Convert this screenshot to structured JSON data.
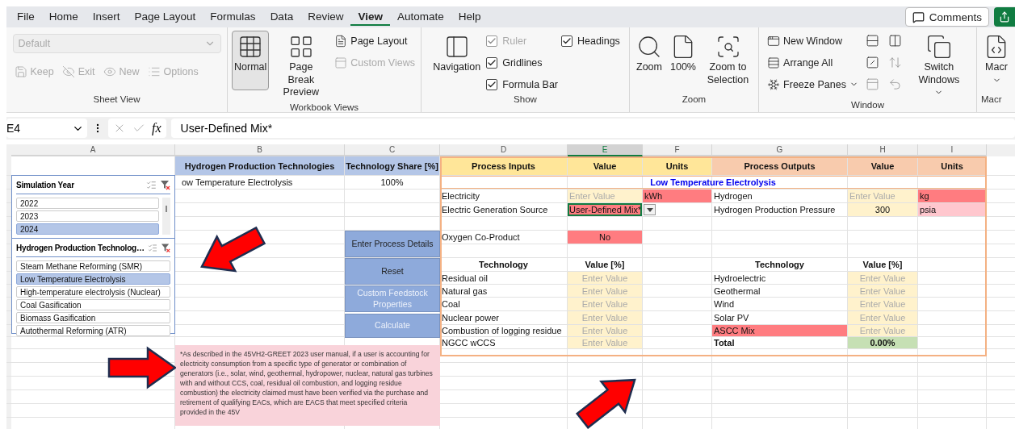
{
  "menu": [
    {
      "label": "File",
      "selected": false
    },
    {
      "label": "Home",
      "selected": false
    },
    {
      "label": "Insert",
      "selected": false
    },
    {
      "label": "Page Layout",
      "selected": false
    },
    {
      "label": "Formulas",
      "selected": false
    },
    {
      "label": "Data",
      "selected": false
    },
    {
      "label": "Review",
      "selected": false
    },
    {
      "label": "View",
      "selected": true
    },
    {
      "label": "Automate",
      "selected": false
    },
    {
      "label": "Help",
      "selected": false
    }
  ],
  "comments_button": "Comments",
  "ribbon": [
    {
      "label": "Sheet View",
      "columns": [
        [
          {
            "kind": "select",
            "value": "Default",
            "disabled": true
          },
          {
            "kind": "row",
            "items": [
              {
                "kind": "small",
                "label": "Keep",
                "disabled": true
              },
              {
                "kind": "small",
                "label": "Exit",
                "disabled": true
              },
              {
                "kind": "small",
                "label": "New",
                "disabled": true
              },
              {
                "kind": "small",
                "label": "Options",
                "disabled": true
              }
            ]
          }
        ]
      ]
    },
    {
      "label": "Workbook Views",
      "columns": [
        [
          {
            "kind": "large",
            "label": "Normal",
            "selected": true
          }
        ],
        [
          {
            "kind": "large",
            "label": "Page Break Preview",
            "selected": false
          }
        ],
        [
          {
            "kind": "small",
            "label": "Page Layout",
            "disabled": false
          },
          {
            "kind": "small",
            "label": "Custom Views",
            "disabled": true
          }
        ]
      ]
    },
    {
      "label": "Show",
      "columns": [
        [
          {
            "kind": "large",
            "label": "Navigation",
            "selected": false
          }
        ],
        [
          {
            "kind": "check",
            "label": "Ruler",
            "checked": true,
            "disabled": true
          },
          {
            "kind": "check",
            "label": "Gridlines",
            "checked": true,
            "disabled": false
          },
          {
            "kind": "check",
            "label": "Formula Bar",
            "checked": true,
            "disabled": false
          }
        ],
        [
          {
            "kind": "check",
            "label": "Headings",
            "checked": true,
            "disabled": false
          }
        ]
      ]
    },
    {
      "label": "Zoom",
      "columns": [
        [
          {
            "kind": "large",
            "label": "Zoom",
            "selected": false
          }
        ],
        [
          {
            "kind": "large",
            "label": "100%",
            "selected": false
          }
        ],
        [
          {
            "kind": "large",
            "label": "Zoom to Selection",
            "selected": false
          }
        ]
      ]
    },
    {
      "label": "Window",
      "columns": [
        [
          {
            "kind": "small",
            "label": "New Window",
            "disabled": false
          },
          {
            "kind": "small",
            "label": "Arrange All",
            "disabled": false
          },
          {
            "kind": "small",
            "label": "Freeze Panes",
            "disabled": false,
            "caret": true
          }
        ],
        [
          {
            "kind": "icon",
            "disabled": false
          },
          {
            "kind": "icon",
            "disabled": false
          },
          {
            "kind": "icon",
            "disabled": true
          }
        ],
        [
          {
            "kind": "icon",
            "disabled": false
          },
          {
            "kind": "icon",
            "disabled": true
          },
          {
            "kind": "icon",
            "disabled": true
          }
        ],
        [
          {
            "kind": "large",
            "label": "Switch Windows",
            "selected": false,
            "caret": true
          }
        ]
      ]
    },
    {
      "label": "Macr",
      "columns": [
        [
          {
            "kind": "large",
            "label": "Macr",
            "selected": false,
            "caret": true
          }
        ]
      ]
    }
  ],
  "name_box": "E4",
  "function_label": "fx",
  "formula": "User-Defined Mix*",
  "columns": [
    {
      "label": "A",
      "selected": false
    },
    {
      "label": "B",
      "selected": false
    },
    {
      "label": "C",
      "selected": false
    },
    {
      "label": "D",
      "selected": false
    },
    {
      "label": "E",
      "selected": true
    },
    {
      "label": "F",
      "selected": false
    },
    {
      "label": "G",
      "selected": false
    },
    {
      "label": "H",
      "selected": false
    },
    {
      "label": "I",
      "selected": false
    }
  ],
  "header_row": [
    {
      "text": "Hydrogen Production Technologies",
      "kind": "technology"
    },
    {
      "text": "Technology Share [%]",
      "kind": "technology"
    },
    {
      "text": "Process Inputs",
      "kind": "input"
    },
    {
      "text": "Value",
      "kind": "input"
    },
    {
      "text": "Units",
      "kind": "input"
    },
    {
      "text": "Process Outputs",
      "kind": "output"
    },
    {
      "text": "Value",
      "kind": "output"
    },
    {
      "text": "Units",
      "kind": "output"
    }
  ],
  "rows": [
    {
      "cells": [
        null,
        {
          "text": "ow Temperature Electrolysis",
          "kind": "text"
        },
        {
          "text": "100%",
          "kind": "center"
        },
        {
          "text": "Low Temperature Electrolysis",
          "kind": "title"
        },
        null,
        null,
        null,
        null,
        null
      ]
    },
    {
      "cells": [
        null,
        null,
        null,
        {
          "text": "Electricity",
          "kind": "text"
        },
        {
          "text": "Enter Value",
          "kind": "hint"
        },
        {
          "text": "kWh",
          "kind": "required"
        },
        {
          "text": "Hydrogen",
          "kind": "text"
        },
        {
          "text": "Enter Value",
          "kind": "hint"
        },
        {
          "text": "kg",
          "kind": "required"
        }
      ]
    },
    {
      "cells": [
        null,
        null,
        null,
        {
          "text": "Electric Generation Source",
          "kind": "text"
        },
        {
          "text": "User-Defined Mix*",
          "kind": "dropdown"
        },
        null,
        {
          "text": "Hydrogen Production Pressure",
          "kind": "text"
        },
        {
          "text": "300",
          "kind": "value"
        },
        {
          "text": "psia",
          "kind": "optional"
        }
      ]
    },
    null,
    {
      "cells": [
        null,
        null,
        null,
        {
          "text": "Oxygen Co-Product",
          "kind": "text"
        },
        {
          "text": "No",
          "kind": "flag"
        },
        null,
        null,
        null,
        null
      ]
    },
    null,
    {
      "cells": [
        null,
        null,
        null,
        {
          "text": "Technology",
          "kind": "heading"
        },
        {
          "text": "Value [%]",
          "kind": "heading"
        },
        null,
        {
          "text": "Technology",
          "kind": "heading"
        },
        {
          "text": "Value [%]",
          "kind": "heading"
        },
        null
      ]
    },
    {
      "cells": [
        null,
        null,
        null,
        {
          "text": "Residual oil",
          "kind": "text"
        },
        {
          "text": "Enter Value",
          "kind": "input"
        },
        null,
        {
          "text": "Hydroelectric",
          "kind": "text"
        },
        {
          "text": "Enter Value",
          "kind": "input"
        },
        null
      ]
    },
    {
      "cells": [
        null,
        null,
        null,
        {
          "text": "Natural gas",
          "kind": "text"
        },
        {
          "text": "Enter Value",
          "kind": "input"
        },
        null,
        {
          "text": "Geothermal",
          "kind": "text"
        },
        {
          "text": "Enter Value",
          "kind": "input"
        },
        null
      ]
    },
    {
      "cells": [
        null,
        null,
        null,
        {
          "text": "Coal",
          "kind": "text"
        },
        {
          "text": "Enter Value",
          "kind": "input"
        },
        null,
        {
          "text": "Wind",
          "kind": "text"
        },
        {
          "text": "Enter Value",
          "kind": "input"
        },
        null
      ]
    },
    {
      "cells": [
        null,
        null,
        null,
        {
          "text": "Nuclear power",
          "kind": "text"
        },
        {
          "text": "Enter Value",
          "kind": "input"
        },
        null,
        {
          "text": "Solar PV",
          "kind": "text"
        },
        {
          "text": "Enter Value",
          "kind": "input"
        },
        null
      ]
    },
    {
      "cells": [
        null,
        null,
        null,
        {
          "text": "Combustion of logging residue",
          "kind": "text"
        },
        {
          "text": "Enter Value",
          "kind": "input"
        },
        null,
        {
          "text": "ASCC Mix",
          "kind": "required"
        },
        {
          "text": "Enter Value",
          "kind": "input"
        },
        null
      ]
    },
    {
      "cells": [
        null,
        null,
        null,
        {
          "text": "NGCC wCCS",
          "kind": "text"
        },
        {
          "text": "Enter Value",
          "kind": "input"
        },
        null,
        {
          "text": "Total",
          "kind": "bold"
        },
        {
          "text": "0.00%",
          "kind": "total"
        },
        null
      ]
    },
    null,
    null,
    null,
    null,
    null,
    null
  ],
  "slicers": [
    {
      "title": "Simulation Year",
      "items": [
        {
          "label": "2022",
          "selected": false
        },
        {
          "label": "2023",
          "selected": false
        },
        {
          "label": "2024",
          "selected": true
        }
      ]
    },
    {
      "title": "Hydrogen Production Technolog…",
      "items": [
        {
          "label": "Steam Methane Reforming (SMR)",
          "selected": false
        },
        {
          "label": "Low Temperature Electrolysis",
          "selected": true
        },
        {
          "label": "High-temperature electrolysis (Nuclear)",
          "selected": false
        },
        {
          "label": "Coal Gasification",
          "selected": false
        },
        {
          "label": "Biomass Gasification",
          "selected": false
        },
        {
          "label": "Autothermal Reforming (ATR)",
          "selected": false
        }
      ]
    }
  ],
  "sheet_buttons": [
    {
      "label": "Enter Process Details",
      "disabled": false
    },
    {
      "label": "Reset",
      "disabled": false
    },
    {
      "label": "Custom Feedstock Properties",
      "disabled": true
    },
    {
      "label": "Calculate",
      "disabled": true
    }
  ],
  "note": "*As described in the 45VH2-GREET 2023 user manual, if a user is accounting for electricity consumption from a specific type of generator or combination of generators (i.e., solar, wind, geothermal, hydropower, nuclear, natural gas turbines with and without CCS, coal, residual oil combustion, and logging residue combustion) the electricity claimed must have been verified via the purchase and retirement of qualifying EACs, which are EACS that meet specified criteria provided in the 45V"
}
